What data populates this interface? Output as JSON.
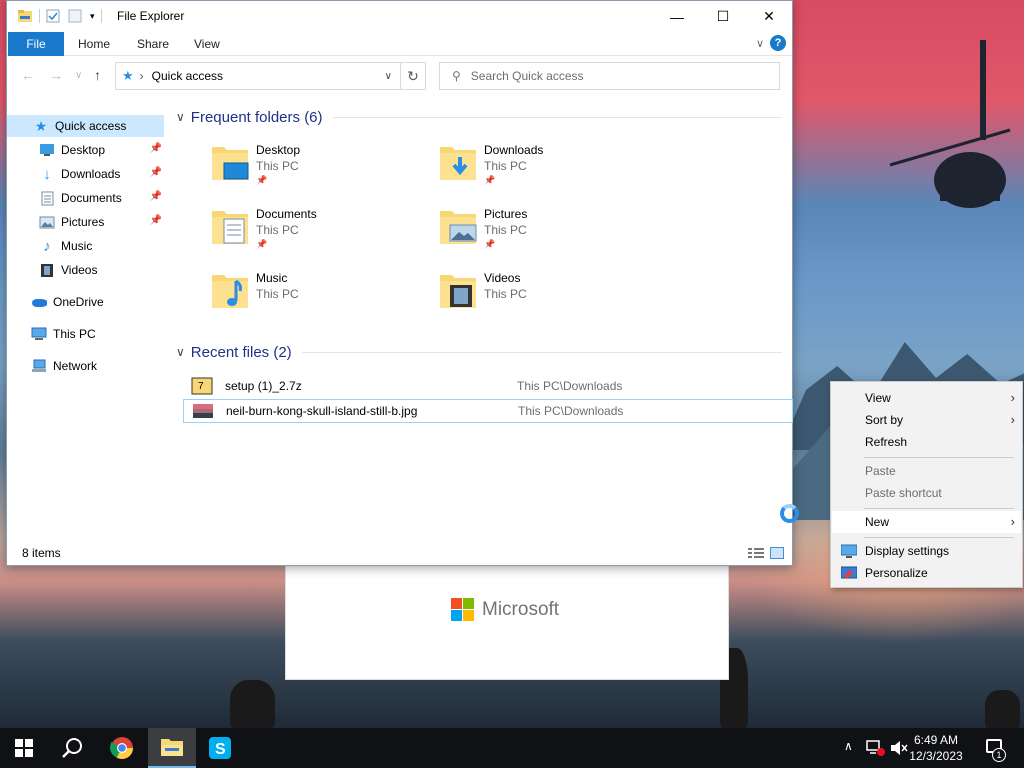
{
  "window": {
    "title": "File Explorer",
    "minimize_glyph": "—",
    "maximize_glyph": "☐",
    "close_glyph": "✕"
  },
  "ribbon": {
    "tabs": [
      "File",
      "Home",
      "Share",
      "View"
    ],
    "help_glyph": "?"
  },
  "address": {
    "location": "Quick access",
    "separator": "›"
  },
  "search": {
    "placeholder": "Search Quick access"
  },
  "navpane": {
    "items": [
      {
        "label": "Quick access",
        "icon": "star-icon",
        "pinned": false,
        "selected": true
      },
      {
        "label": "Desktop",
        "icon": "desktop-icon",
        "pinned": true
      },
      {
        "label": "Downloads",
        "icon": "download-icon",
        "pinned": true
      },
      {
        "label": "Documents",
        "icon": "documents-icon",
        "pinned": true
      },
      {
        "label": "Pictures",
        "icon": "pictures-icon",
        "pinned": true
      },
      {
        "label": "Music",
        "icon": "music-icon",
        "pinned": false
      },
      {
        "label": "Videos",
        "icon": "videos-icon",
        "pinned": false
      },
      {
        "label": "OneDrive",
        "icon": "cloud-icon",
        "pinned": false
      },
      {
        "label": "This PC",
        "icon": "pc-icon",
        "pinned": false
      },
      {
        "label": "Network",
        "icon": "network-icon",
        "pinned": false
      }
    ]
  },
  "frequent": {
    "header": "Frequent folders (6)",
    "folders": [
      {
        "name": "Desktop",
        "location": "This PC",
        "pinned": true
      },
      {
        "name": "Downloads",
        "location": "This PC",
        "pinned": true
      },
      {
        "name": "Documents",
        "location": "This PC",
        "pinned": true
      },
      {
        "name": "Pictures",
        "location": "This PC",
        "pinned": true
      },
      {
        "name": "Music",
        "location": "This PC",
        "pinned": false
      },
      {
        "name": "Videos",
        "location": "This PC",
        "pinned": false
      }
    ]
  },
  "recent": {
    "header": "Recent files (2)",
    "files": [
      {
        "name": "setup (1)_2.7z",
        "location": "This PC\\Downloads"
      },
      {
        "name": "neil-burn-kong-skull-island-still-b.jpg",
        "location": "This PC\\Downloads"
      }
    ]
  },
  "status": {
    "item_count": "8 items"
  },
  "background_window": {
    "brand": "Microsoft"
  },
  "context_menu": {
    "items": [
      {
        "label": "View",
        "submenu": true,
        "disabled": false
      },
      {
        "label": "Sort by",
        "submenu": true,
        "disabled": false
      },
      {
        "label": "Refresh",
        "submenu": false,
        "disabled": false
      },
      {
        "label": "Paste",
        "submenu": false,
        "disabled": true
      },
      {
        "label": "Paste shortcut",
        "submenu": false,
        "disabled": true
      },
      {
        "label": "New",
        "submenu": true,
        "disabled": false
      },
      {
        "label": "Display settings",
        "submenu": false,
        "disabled": false
      },
      {
        "label": "Personalize",
        "submenu": false,
        "disabled": false
      }
    ],
    "arrow_glyph": "›"
  },
  "taskbar": {
    "time": "6:49 AM",
    "date": "12/3/2023",
    "notification_count": "1"
  },
  "colors": {
    "accent": "#1979ca",
    "selection": "#cce8ff",
    "folder_yellow": "#f8d775",
    "taskbar": "#101114"
  }
}
